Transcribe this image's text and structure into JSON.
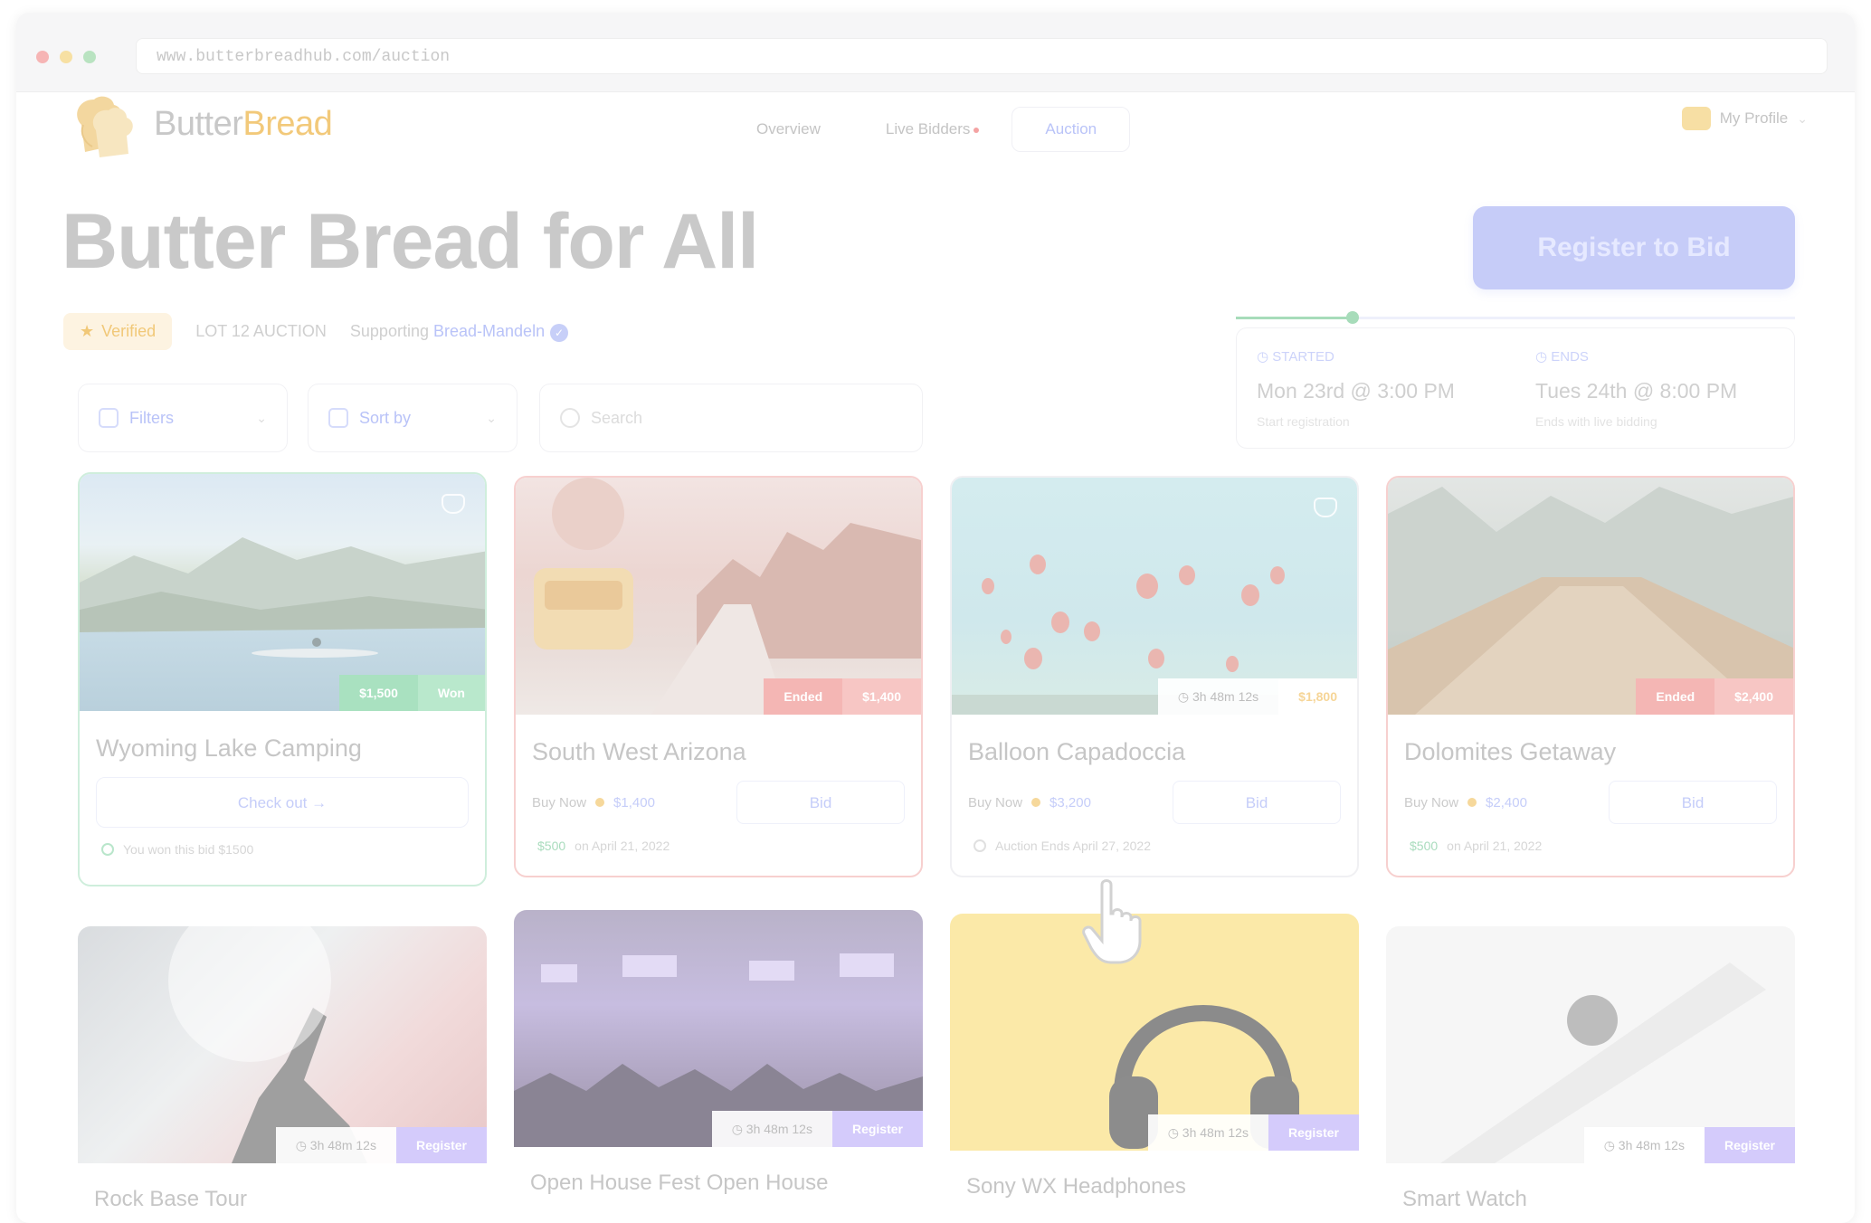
{
  "browser": {
    "url": "www.butterbreadhub.com/auction",
    "dots": [
      "#f6b5b5",
      "#f7e0a3",
      "#b9e3c1"
    ]
  },
  "nav": {
    "logo_text_1": "Butter",
    "logo_text_2": "Bread",
    "items": [
      {
        "label": "Overview"
      },
      {
        "label": "Live Bidders"
      },
      {
        "label": "Auction"
      }
    ],
    "profile_label": "My Profile"
  },
  "header": {
    "title": "Butter Bread for All",
    "badge": "Verified",
    "lot": "LOT 12 AUCTION",
    "supporting_prefix": "Supporting",
    "supporting_name": "Bread-Mandeln"
  },
  "actions": {
    "register_label": "Register to Bid"
  },
  "timeline": {
    "start_label": "STARTED",
    "start_value": "Mon 23rd @ 3:00 PM",
    "start_sub": "Start registration",
    "end_label": "ENDS",
    "end_value": "Tues 24th @ 8:00 PM",
    "end_sub": "Ends with live bidding"
  },
  "controls": {
    "filters_label": "Filters",
    "sort_label": "Sort by",
    "search_placeholder": "Search"
  },
  "cards": [
    {
      "name": "Wyoming Lake Camping",
      "tags": [
        "$1,500",
        "Won"
      ],
      "button": "Check out",
      "foot": "You won this bid $1500"
    },
    {
      "name": "South West Arizona",
      "tags": [
        "Ended",
        "$1,400"
      ],
      "buy_label": "Buy Now",
      "buy_price": "$1,400",
      "bid_label": "Bid",
      "foot_pill": "$500",
      "foot_text": "on April 21, 2022"
    },
    {
      "name": "Balloon Capadoccia",
      "timer": "3h 48m 12s",
      "tags": [
        "$1,800"
      ],
      "buy_label": "Buy Now",
      "buy_price": "$3,200",
      "bid_label": "Bid",
      "foot_text": "Auction Ends April 27, 2022"
    },
    {
      "name": "Dolomites Getaway",
      "tags": [
        "Ended",
        "$2,400"
      ],
      "buy_label": "Buy Now",
      "buy_price": "$2,400",
      "bid_label": "Bid",
      "foot_pill": "$500",
      "foot_text": "on April 21, 2022"
    },
    {
      "name": "Rock Base Tour",
      "timer": "3h 48m 12s",
      "tags": [
        "Register"
      ]
    },
    {
      "name": "Open House Fest Open House",
      "timer": "3h 48m 12s",
      "tags": [
        "Register"
      ]
    },
    {
      "name": "Sony WX Headphones",
      "timer": "3h 48m 12s",
      "tags": [
        "Register"
      ]
    },
    {
      "name": "Smart Watch",
      "timer": "3h 48m 12s",
      "tags": [
        "Register"
      ]
    }
  ],
  "colors": {
    "accent": "#c6ccf8",
    "won": "#a9e1c0",
    "ended": "#f4b6b4",
    "register": "#d4cbfb"
  }
}
